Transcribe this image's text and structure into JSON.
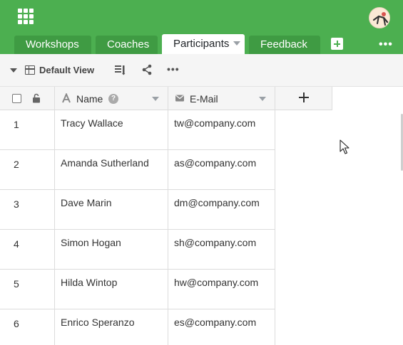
{
  "header": {
    "app_menu_icon": "grid-icon",
    "avatar_icon": "user-avatar",
    "brand_color": "#4caf50",
    "tabs": [
      {
        "label": "Workshops",
        "active": false
      },
      {
        "label": "Coaches",
        "active": false
      },
      {
        "label": "Participants",
        "active": true
      },
      {
        "label": "Feedback",
        "active": false
      }
    ],
    "add_tab_icon": "plus-square-icon",
    "more_icon": "more-horizontal-icon",
    "more_label": "•••"
  },
  "toolbar": {
    "view_label": "Default View",
    "view_icon": "table-icon",
    "columns_icon": "columns-icon",
    "share_icon": "share-icon",
    "more_label": "•••"
  },
  "grid": {
    "columns": [
      {
        "label": "Name",
        "type_icon": "text-type-icon",
        "help": "?"
      },
      {
        "label": "E-Mail",
        "type_icon": "email-type-icon"
      }
    ],
    "add_column_icon": "plus-icon",
    "rows": [
      {
        "num": "1",
        "name": "Tracy Wallace",
        "email": "tw@company.com"
      },
      {
        "num": "2",
        "name": "Amanda Sutherland",
        "email": "as@company.com"
      },
      {
        "num": "3",
        "name": "Dave Marin",
        "email": "dm@company.com"
      },
      {
        "num": "4",
        "name": "Simon Hogan",
        "email": "sh@company.com"
      },
      {
        "num": "5",
        "name": "Hilda Wintop",
        "email": "hw@company.com"
      },
      {
        "num": "6",
        "name": "Enrico Speranzo",
        "email": "es@company.com"
      }
    ]
  }
}
